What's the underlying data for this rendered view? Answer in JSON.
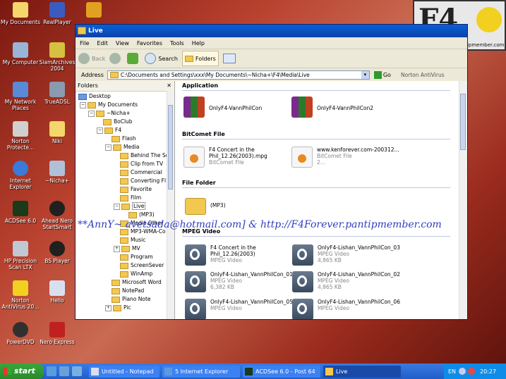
{
  "desktop": {
    "icons": [
      {
        "label": "My Documents"
      },
      {
        "label": "RealPlayer"
      },
      {
        "label": ""
      },
      {
        "label": "My Computer"
      },
      {
        "label": "SiamArchives 2004"
      },
      {
        "label": "My Network Places"
      },
      {
        "label": "TrueADSL"
      },
      {
        "label": "Norton Protecte..."
      },
      {
        "label": "Niki"
      },
      {
        "label": "Internet Explorer"
      },
      {
        "label": "~Nicha+"
      },
      {
        "label": "ACDSee 6.0"
      },
      {
        "label": "Ahead Nero StartSmart"
      },
      {
        "label": "HP Precision Scan LTX"
      },
      {
        "label": "BS Player"
      },
      {
        "label": "Norton AntiVirus 20..."
      },
      {
        "label": "Hello"
      },
      {
        "label": "PowerDVD"
      },
      {
        "label": "Nero Express"
      }
    ]
  },
  "logo": {
    "text": "F4",
    "url": "http://f4forever.pantipmember.com"
  },
  "window": {
    "title": "Live",
    "menu": [
      "File",
      "Edit",
      "View",
      "Favorites",
      "Tools",
      "Help"
    ],
    "toolbar": {
      "back": "Back",
      "search": "Search",
      "folders": "Folders"
    },
    "address": {
      "label": "Address",
      "value": "C:\\Documents and Settings\\xxx\\My Documents\\~Nicha+\\F4\\Media\\Live",
      "go": "Go",
      "norton": "Norton AntiVirus"
    },
    "tree": {
      "header": "Folders",
      "rows": [
        {
          "label": "Desktop"
        },
        {
          "label": "My Documents"
        },
        {
          "label": "~Nicha+"
        },
        {
          "label": "BoClub"
        },
        {
          "label": "F4"
        },
        {
          "label": "Flash"
        },
        {
          "label": "Media"
        },
        {
          "label": "Behind The Sc"
        },
        {
          "label": "Clip from TV"
        },
        {
          "label": "Commercial"
        },
        {
          "label": "Converting Fl"
        },
        {
          "label": "Favorite"
        },
        {
          "label": "Film"
        },
        {
          "label": "Live"
        },
        {
          "label": "(MP3)"
        },
        {
          "label": "Media Other"
        },
        {
          "label": "MP3-WMA-Co"
        },
        {
          "label": "Music"
        },
        {
          "label": "MV"
        },
        {
          "label": "Program"
        },
        {
          "label": "ScreenSever"
        },
        {
          "label": "WinAmp"
        },
        {
          "label": "Microsoft Word"
        },
        {
          "label": "NotePad"
        },
        {
          "label": "Piano Note"
        },
        {
          "label": "Pic"
        }
      ]
    },
    "groups": {
      "application": "Application",
      "bitcomet": "BitComet File",
      "folder": "File Folder",
      "mpeg": "MPEG Video"
    },
    "files": {
      "app1": {
        "name": "OnlyF4-VannPhilCon"
      },
      "app2": {
        "name": "OnlyF4-VannPhilCon2"
      },
      "bc1": {
        "name": "F4 Concert in the Phil_12.26(2003).mpg",
        "type": "BitComet File"
      },
      "bc2": {
        "name": "www.kenforever.com-200312...",
        "type": "BitComet File",
        "size": "2..."
      },
      "fold1": {
        "name": "(MP3)"
      },
      "mp1": {
        "name": "F4 Concert in the Phil_12.26(2003)",
        "type": "MPEG Video"
      },
      "mp2": {
        "name": "OnlyF4-Lishan_VannPhilCon_03",
        "type": "MPEG Video",
        "size": "4,865 KB"
      },
      "mp3": {
        "name": "OnlyF4-Lishan_VannPhilCon_01",
        "type": "MPEG Video",
        "size": "6,382 KB"
      },
      "mp4": {
        "name": "OnlyF4-Lishan_VannPhilCon_02",
        "type": "MPEG Video",
        "size": "4,865 KB"
      },
      "mp5": {
        "name": "OnlyF4-Lishan_VannPhilCon_05",
        "type": "MPEG Video"
      },
      "mp6": {
        "name": "OnlyF4-Lishan_VannPhilCon_06",
        "type": "MPEG Video"
      }
    }
  },
  "watermark": "**AnnY~  avetsada@hotmail.com] & http://F4Forever.pantipmember.com",
  "taskbar": {
    "start": "start",
    "tasks": [
      "Untitled - Notepad",
      "5 Internet Explorer",
      "ACDSee 6.0 - Post 64",
      "Live"
    ],
    "lang": "EN",
    "clock": "20:27"
  }
}
